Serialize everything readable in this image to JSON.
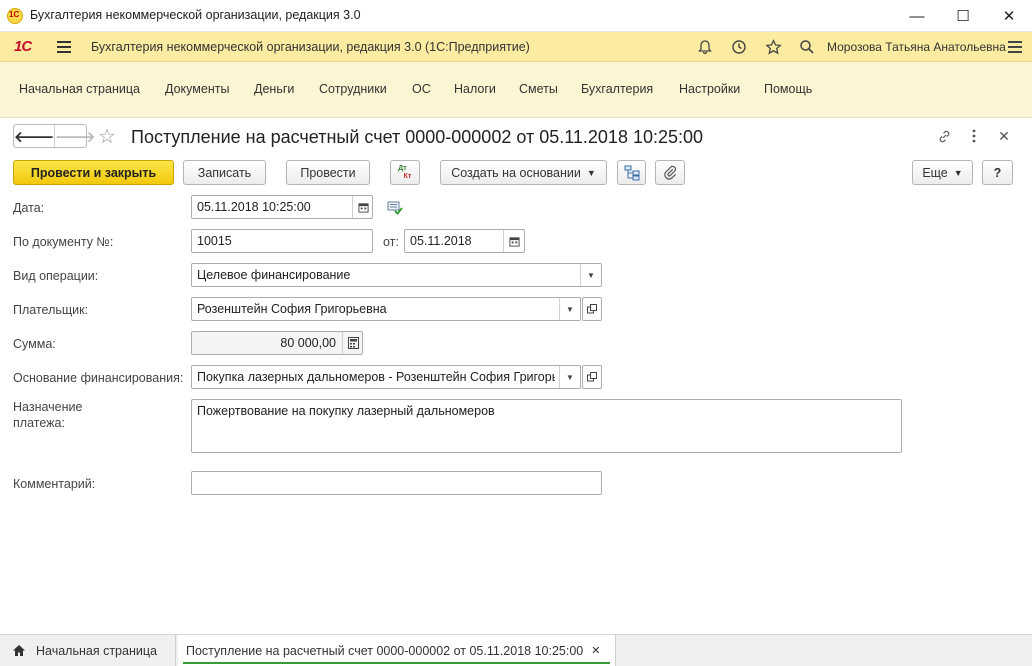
{
  "window": {
    "title": "Бухгалтерия некоммерческой организации, редакция 3.0",
    "logo_text": "1С",
    "minimize": "—",
    "maximize": "☐",
    "close": "✕"
  },
  "appbar": {
    "logo": "1С",
    "title": "Бухгалтерия некоммерческой организации, редакция 3.0  (1С:Предприятие)",
    "user": "Морозова Татьяна Анатольевна",
    "icons": [
      "bell-icon",
      "history-icon",
      "star-icon",
      "search-icon",
      "menu-icon"
    ]
  },
  "sections": [
    "Начальная страница",
    "Документы",
    "Деньги",
    "Сотрудники",
    "ОС",
    "Налоги",
    "Сметы",
    "Бухгалтерия",
    "Настройки",
    "Помощь"
  ],
  "form": {
    "title": "Поступление на расчетный счет 0000-000002 от 05.11.2018 10:25:00",
    "toolbar": {
      "post_close": "Провести и закрыть",
      "save": "Записать",
      "post": "Провести",
      "dtkt_top": "Дт",
      "dtkt_bottom": "Кт",
      "create_based": "Создать на основании",
      "more": "Еще",
      "help": "?"
    },
    "fields": {
      "date_label": "Дата:",
      "date_value": "05.11.2018 10:25:00",
      "doc_label": "По документу №:",
      "doc_value": "10015",
      "from_label": "от:",
      "from_value": "05.11.2018",
      "op_label": "Вид операции:",
      "op_value": "Целевое финансирование",
      "payer_label": "Плательщик:",
      "payer_value": "Розенштейн София Григорьевна",
      "sum_label": "Сумма:",
      "sum_value": "80 000,00",
      "basis_label": "Основание финансирования:",
      "basis_value": "Покупка лазерных дальномеров - Розенштейн София Григорьевна",
      "purpose_label_1": "Назначение",
      "purpose_label_2": "платежа:",
      "purpose_value": "Пожертвование на покупку лазерный дальномеров",
      "comment_label": "Комментарий:",
      "comment_value": ""
    }
  },
  "tabs": {
    "home": "Начальная страница",
    "active": "Поступление на расчетный счет 0000-000002 от 05.11.2018 10:25:00",
    "close": "✕"
  }
}
